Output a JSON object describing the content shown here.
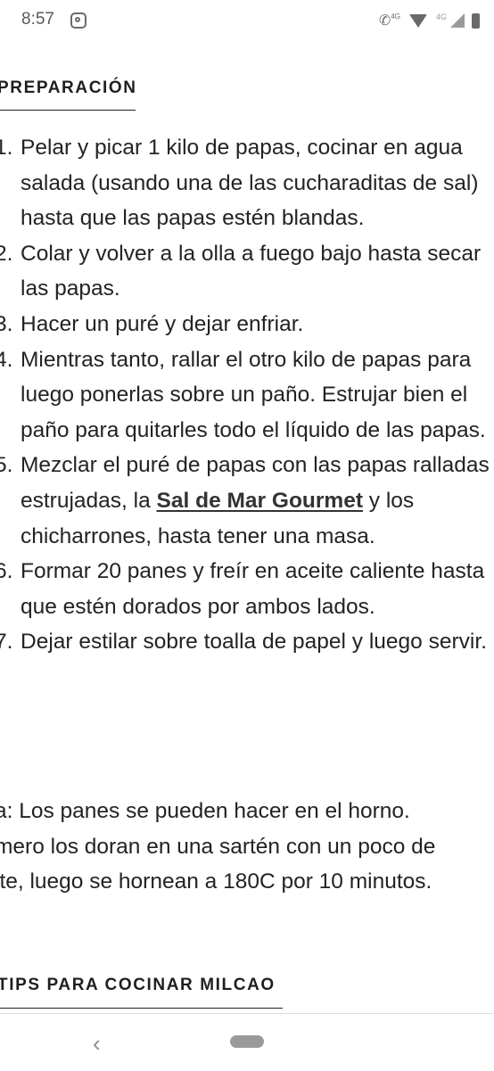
{
  "status_bar": {
    "time": "8:57",
    "network_small": "4G",
    "network_label": "4G"
  },
  "preparation": {
    "heading": "PREPARACIÓN",
    "steps": [
      {
        "num": "1.",
        "text": "Pelar y picar 1 kilo de papas, cocinar en agua salada (usando una de las cucharaditas de sal) hasta que las papas estén blandas."
      },
      {
        "num": "2.",
        "text": "Colar y volver a la olla a fuego bajo hasta secar las papas."
      },
      {
        "num": "3.",
        "text": "Hacer un puré y dejar enfriar."
      },
      {
        "num": "4.",
        "text": "Mientras tanto, rallar el otro kilo de papas para luego ponerlas sobre un paño. Estrujar bien el paño para quitarles todo el líquido de las papas."
      },
      {
        "num": "5.",
        "text_before": "Mezclar el puré de papas con las papas ralladas estrujadas, la ",
        "link": "Sal de Mar Gourmet",
        "text_after": " y los chicharrones, hasta tener una masa."
      },
      {
        "num": "6.",
        "text": "Formar 20 panes y freír en aceite caliente hasta que estén dorados por ambos lados."
      },
      {
        "num": "7.",
        "text": "Dejar estilar sobre toalla de papel y luego servir."
      }
    ]
  },
  "note": {
    "lines": [
      "a: Los panes se pueden hacer en el horno.",
      "mero los doran en una sartén con un poco de",
      "ite, luego se hornean a 180C por 10 minutos."
    ]
  },
  "tips": {
    "heading": "TIPS PARA COCINAR MILCAO"
  },
  "nav": {
    "back_glyph": "‹"
  }
}
